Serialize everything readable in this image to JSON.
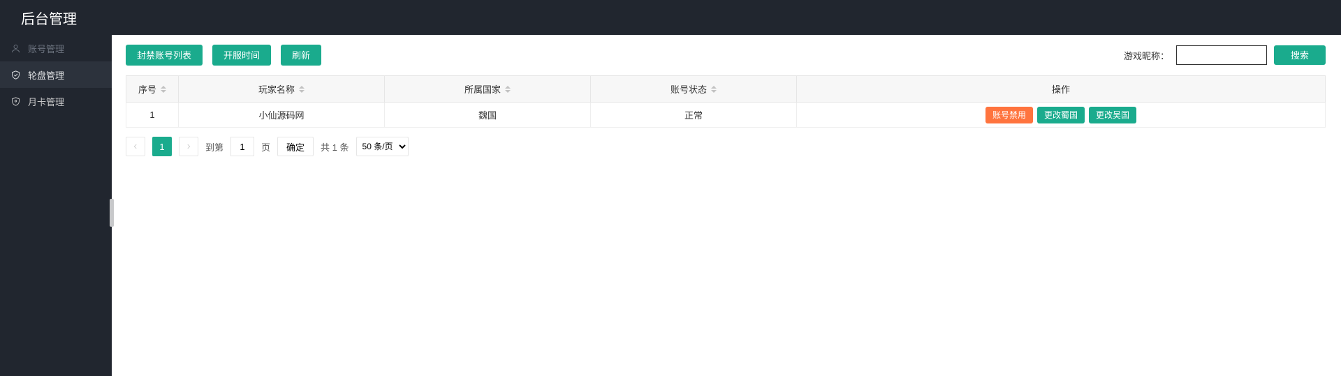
{
  "header": {
    "title": "后台管理"
  },
  "sidebar": {
    "items": [
      {
        "label": "账号管理"
      },
      {
        "label": "轮盘管理"
      },
      {
        "label": "月卡管理"
      }
    ]
  },
  "toolbar": {
    "banned_list": "封禁账号列表",
    "open_time": "开服时间",
    "refresh": "刷新"
  },
  "search": {
    "label": "游戏昵称：",
    "value": "",
    "button": "搜索"
  },
  "table": {
    "cols": {
      "idx": "序号",
      "name": "玩家名称",
      "country": "所属国家",
      "status": "账号状态",
      "ops": "操作"
    },
    "rows": [
      {
        "idx": "1",
        "name": "小仙源码网",
        "country": "魏国",
        "status": "正常",
        "actions": {
          "disable": "账号禁用",
          "change_shu": "更改蜀国",
          "change_wu": "更改吴国"
        }
      }
    ]
  },
  "pager": {
    "current": "1",
    "goto_label": "到第",
    "goto_value": "1",
    "page_label": "页",
    "confirm": "确定",
    "total": "共 1 条",
    "per_page": "50 条/页"
  }
}
